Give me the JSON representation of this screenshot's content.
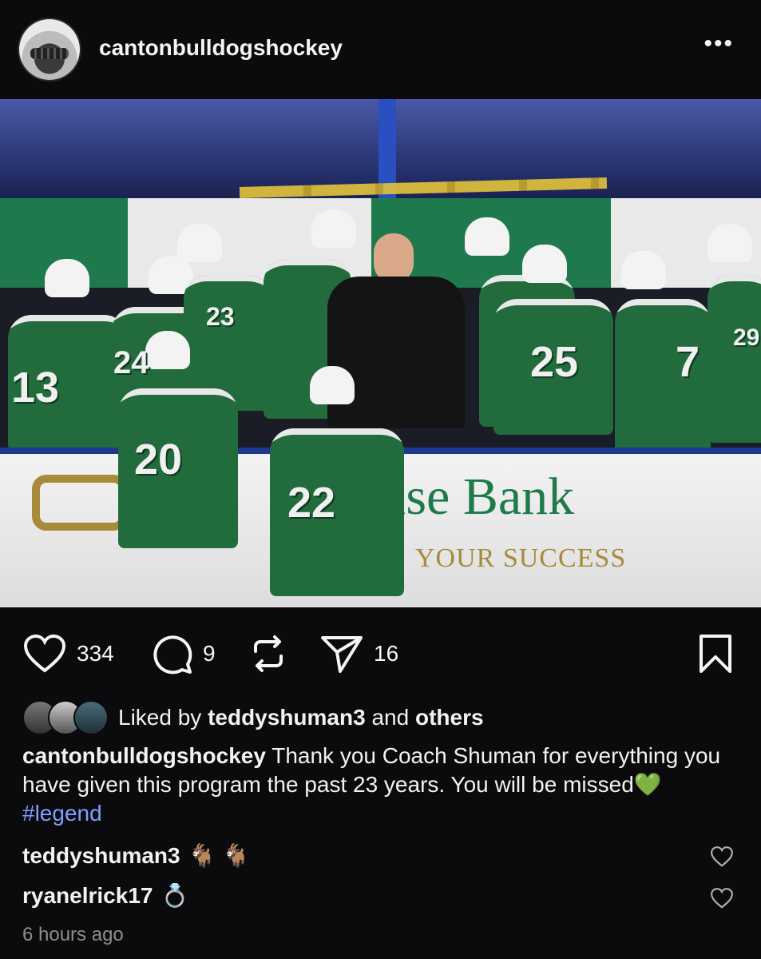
{
  "header": {
    "username": "cantonbulldogshockey",
    "more_icon": "more-horizontal-icon",
    "more_label": "•••"
  },
  "photo": {
    "bank_text": "ise Bank",
    "bank_slogan": "YOUR SUCCESS",
    "jersey_numbers": [
      "13",
      "20",
      "22",
      "25",
      "7",
      "29",
      "24",
      "23"
    ]
  },
  "actions": {
    "likes": "334",
    "comments": "9",
    "shares": "16",
    "icons": [
      "heart-icon",
      "comment-icon",
      "repost-icon",
      "send-icon",
      "bookmark-icon"
    ]
  },
  "liked_by": {
    "prefix": "Liked by",
    "user": "teddyshuman3",
    "and": "and",
    "others": "others"
  },
  "caption": {
    "username": "cantonbulldogshockey",
    "text": "Thank you Coach Shuman for everything you have given this program the past 23 years. You will be missed",
    "emoji": "💚",
    "hashtag": "#legend"
  },
  "comments": [
    {
      "user": "teddyshuman3",
      "text": "🐐 🐐"
    },
    {
      "user": "ryanelrick17",
      "text": "💍"
    }
  ],
  "timestamp": "6 hours ago"
}
